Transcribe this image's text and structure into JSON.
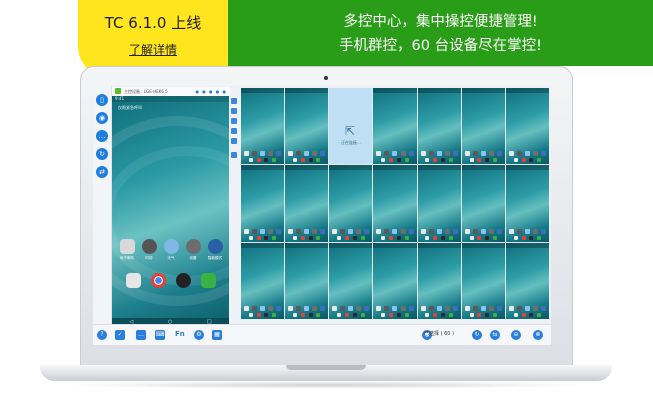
{
  "promo": {
    "version": "TC 6.1.0 上线",
    "details_link": "了解详情",
    "line1": "多控中心，集中操控便捷管理!",
    "line2": "手机群控，60 台设备尽在掌控!"
  },
  "phone_panel": {
    "device_label": "主控设备 : LGE-HEK6 5",
    "status_text": "9:41",
    "carrier_text": "仅限紧急呼叫",
    "apps_row1": [
      {
        "label": "电子邮件",
        "icon": "email-icon",
        "color": "#d9d9d9"
      },
      {
        "label": "时钟",
        "icon": "clock-icon",
        "color": "#555555"
      },
      {
        "label": "天气",
        "icon": "weather-icon",
        "color": "#7fb8e6"
      },
      {
        "label": "设置",
        "icon": "settings-icon",
        "color": "#6d6d6d"
      },
      {
        "label": "智能模式",
        "icon": "steering-icon",
        "color": "#2a5fa8"
      }
    ],
    "apps_row2": [
      {
        "label": "",
        "icon": "dialer-grid-icon",
        "color": "#e6e6e6"
      },
      {
        "label": "",
        "icon": "chrome-icon",
        "color": "#ffffff"
      },
      {
        "label": "",
        "icon": "camera-icon",
        "color": "#222222"
      },
      {
        "label": "",
        "icon": "phone-icon",
        "color": "#3cb043"
      }
    ]
  },
  "grid": {
    "pending_label": "正在连接...",
    "rows": 3,
    "cols": 7
  },
  "toolbar": {
    "fn_label": "Fn",
    "selected_text": "已选择 ( 60 )"
  },
  "colors": {
    "accent": "#2a7ee0",
    "promo_yellow": "#ffe51e",
    "promo_green": "#2a9d18"
  }
}
